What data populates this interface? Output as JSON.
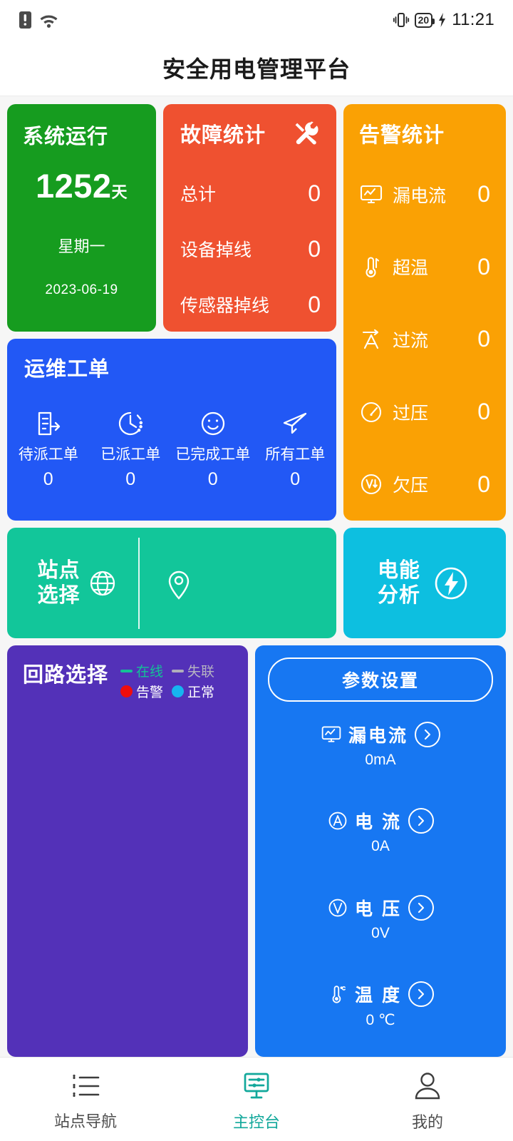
{
  "statusbar": {
    "sim_icon": "sim-card-icon",
    "wifi_icon": "wifi-icon",
    "vibrate_icon": "vibrate-icon",
    "battery_level": "20",
    "charging_icon": "charging-bolt-icon",
    "time": "11:21"
  },
  "header": {
    "title": "安全用电管理平台"
  },
  "system_card": {
    "title": "系统运行",
    "days_value": "1252",
    "days_unit": "天",
    "weekday": "星期一",
    "date": "2023-06-19",
    "color": "#169c1f"
  },
  "fault_card": {
    "title": "故障统计",
    "icon": "tools-icon",
    "color": "#ef5130",
    "items": [
      {
        "label": "总计",
        "value": "0"
      },
      {
        "label": "设备掉线",
        "value": "0"
      },
      {
        "label": "传感器掉线",
        "value": "0"
      }
    ]
  },
  "alarm_card": {
    "title": "告警统计",
    "color": "#faa104",
    "items": [
      {
        "label": "漏电流",
        "value": "0",
        "icon": "monitor-wave-icon"
      },
      {
        "label": "超温",
        "value": "0",
        "icon": "thermometer-icon"
      },
      {
        "label": "过流",
        "value": "0",
        "icon": "current-arrow-icon"
      },
      {
        "label": "过压",
        "value": "0",
        "icon": "gauge-icon"
      },
      {
        "label": "欠压",
        "value": "0",
        "icon": "voltage-down-icon"
      }
    ]
  },
  "work_card": {
    "title": "运维工单",
    "color": "#2258f5",
    "items": [
      {
        "label": "待派工单",
        "value": "0",
        "icon": "doc-arrow-icon"
      },
      {
        "label": "已派工单",
        "value": "0",
        "icon": "clock-dashed-icon"
      },
      {
        "label": "已完成工单",
        "value": "0",
        "icon": "smiley-icon"
      },
      {
        "label": "所有工单",
        "value": "0",
        "icon": "paper-plane-icon"
      }
    ]
  },
  "site_card": {
    "title_line1": "站点",
    "title_line2": "选择",
    "globe_icon": "globe-icon",
    "pin_icon": "location-pin-icon",
    "color": "#12c69a"
  },
  "energy_card": {
    "title_line1": "电能",
    "title_line2": "分析",
    "icon": "lightning-bolt-icon",
    "color": "#0dbfe0"
  },
  "loop_card": {
    "title": "回路选择",
    "color": "#5331b8",
    "legend": [
      {
        "label": "在线",
        "marker": "dash",
        "color": "#13c296"
      },
      {
        "label": "失联",
        "marker": "dash",
        "color": "#b0aebb"
      },
      {
        "label": "告警",
        "marker": "dot",
        "color": "#f00d0d"
      },
      {
        "label": "正常",
        "marker": "dot",
        "color": "#16b4f0"
      }
    ]
  },
  "param_card": {
    "button_label": "参数设置",
    "color": "#1777f2",
    "items": [
      {
        "label": "漏电流",
        "value": "0mA",
        "icon": "monitor-wave-icon",
        "chevron": "chevron-right-icon"
      },
      {
        "label": "电 流",
        "value": "0A",
        "icon": "ampere-circle-icon",
        "chevron": "chevron-right-icon"
      },
      {
        "label": "电 压",
        "value": "0V",
        "icon": "volt-circle-icon",
        "chevron": "chevron-right-icon"
      },
      {
        "label": "温 度",
        "value": "0 ℃",
        "icon": "thermometer-celsius-icon",
        "chevron": "chevron-right-icon"
      }
    ]
  },
  "bottom_nav": {
    "active_color": "#12a89b",
    "items": [
      {
        "label": "站点导航",
        "icon": "list-icon",
        "active": false
      },
      {
        "label": "主控台",
        "icon": "console-icon",
        "active": true
      },
      {
        "label": "我的",
        "icon": "person-icon",
        "active": false
      }
    ]
  }
}
